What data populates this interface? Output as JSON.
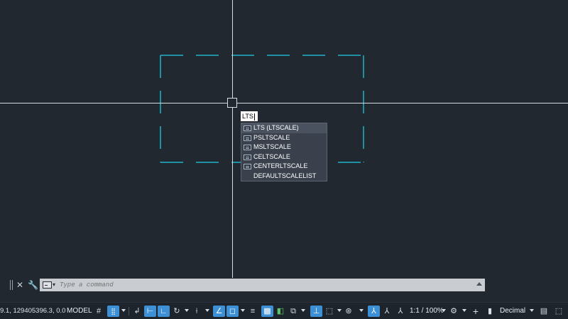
{
  "dynamic_input": {
    "value": "LTS"
  },
  "autocomplete": {
    "items": [
      {
        "label": "LTS (LTSCALE)",
        "icon": "command-icon",
        "selected": true
      },
      {
        "label": "PSLTSCALE",
        "icon": "command-icon",
        "selected": false
      },
      {
        "label": "MSLTSCALE",
        "icon": "command-icon",
        "selected": false
      },
      {
        "label": "CELTSCALE",
        "icon": "command-icon",
        "selected": false
      },
      {
        "label": "CENTERLTSCALE",
        "icon": "command-icon",
        "selected": false
      },
      {
        "label": "DEFAULTSCALELIST",
        "icon": "",
        "selected": false
      }
    ]
  },
  "command_line": {
    "placeholder": "Type a command",
    "close_icon": "close-icon",
    "customize_icon": "wrench-icon"
  },
  "status_bar": {
    "coordinates": "9.1, 129405396.3, 0.0",
    "model_label": "MODEL",
    "annotation_scale": "1:1 / 100%",
    "units": "Decimal"
  },
  "colors": {
    "canvas_bg": "#212830",
    "crosshair": "#d8dde3",
    "dashed_rect": "#1fb4c8",
    "active_toggle": "#3d8fd6"
  }
}
